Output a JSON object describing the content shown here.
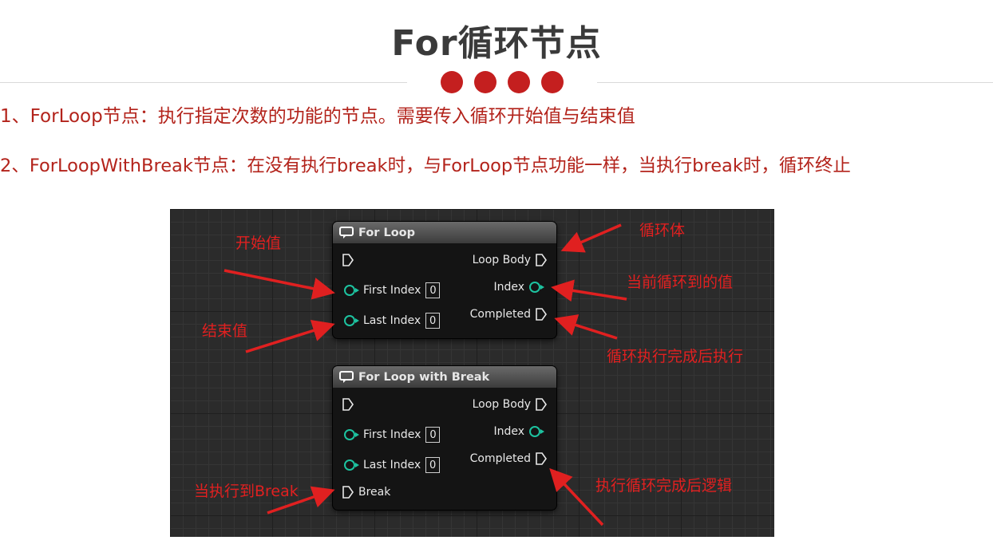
{
  "slide": {
    "title": "For循环节点",
    "line1": "1、ForLoop节点：执行指定次数的功能的节点。需要传入循环开始值与结束值",
    "line2": "2、ForLoopWithBreak节点：在没有执行break时，与ForLoop节点功能一样，当执行break时，循环终止",
    "accent_color": "#c41f1f",
    "text_color": "#b3231b"
  },
  "node1": {
    "title": "For Loop",
    "first_index_label": "First Index",
    "first_index_value": "0",
    "last_index_label": "Last Index",
    "last_index_value": "0",
    "loop_body_label": "Loop Body",
    "index_label": "Index",
    "completed_label": "Completed"
  },
  "node2": {
    "title": "For Loop with Break",
    "first_index_label": "First Index",
    "first_index_value": "0",
    "last_index_label": "Last Index",
    "last_index_value": "0",
    "loop_body_label": "Loop Body",
    "index_label": "Index",
    "completed_label": "Completed",
    "break_label": "Break"
  },
  "annotations": {
    "start_value": "开始值",
    "end_value": "结束值",
    "loop_body": "循环体",
    "current_index": "当前循环到的值",
    "after_complete": "循环执行完成后执行",
    "on_break": "当执行到Break",
    "after_complete_logic": "执行循环完成后逻辑"
  },
  "icons": [
    "loop-icon",
    "exec-pin-icon",
    "data-pin-icon",
    "red-arrow-icon"
  ]
}
